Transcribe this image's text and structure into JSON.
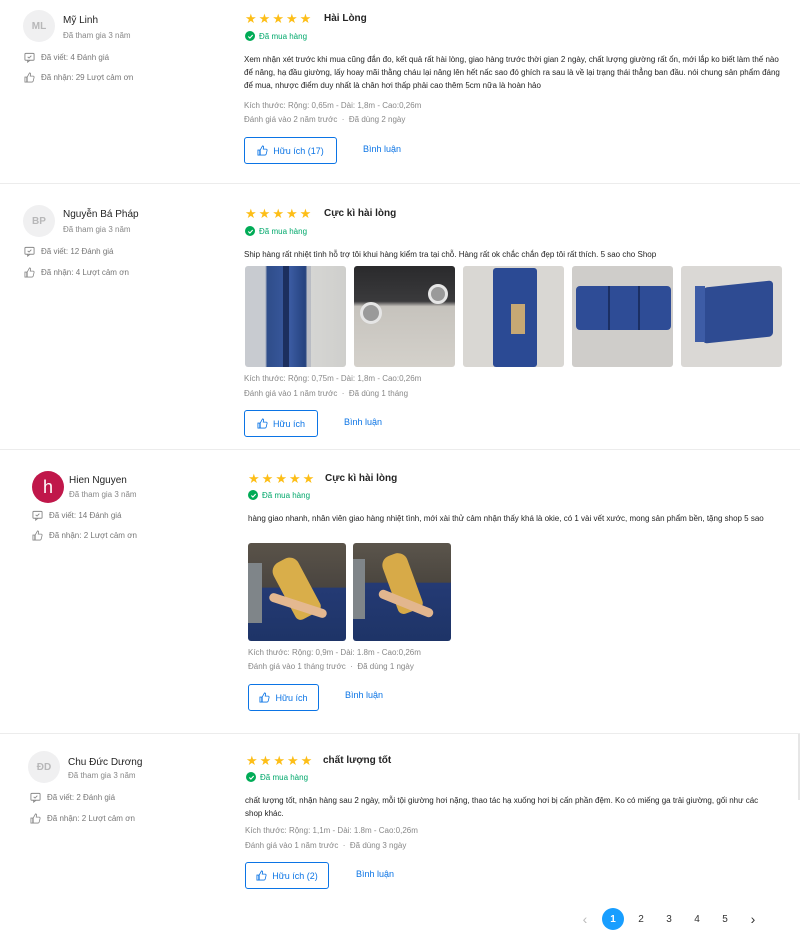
{
  "reviews": [
    {
      "user": {
        "initials": "ML",
        "name": "Mỹ Linh",
        "joined": "Đã tham gia 3 năm",
        "written": "Đã viết: 4 Đánh giá",
        "received": "Đã nhận: 29 Lượt cảm ơn"
      },
      "stars": 5,
      "title": "Hài Lòng",
      "bought": "Đã mua hàng",
      "content": "Xem nhận xét trước khi mua cũng đắn đo, kết quả rất hài lòng, giao hàng trước thời gian 2 ngày, chất lượng giường rất ổn, mới lắp ko biết làm thế nào để nâng, hạ đầu giường, lấy hoay mãi thằng cháu lại nâng lên hết nấc sao đó ghích ra sau là về lại trạng thái thẳng ban đầu. nói chung sản phẩm đáng để mua, nhược điểm duy nhất là chân hơi thấp phải cao thêm 5cm nữa là hoàn hảo",
      "size": "Kích thước: Rộng: 0,65m - Dài: 1,8m - Cao:0,26m",
      "reviewed": "Đánh giá vào 2 năm trước",
      "used": "Đã dùng 2 ngày",
      "helpful": "Hữu ích (17)",
      "comment": "Bình luận"
    },
    {
      "user": {
        "initials": "BP",
        "name": "Nguyễn Bá Pháp",
        "joined": "Đã tham gia 3 năm",
        "written": "Đã viết: 12 Đánh giá",
        "received": "Đã nhận: 4 Lượt cảm ơn"
      },
      "stars": 5,
      "title": "Cực kì hài lòng",
      "bought": "Đã mua hàng",
      "content": "Ship hàng rất nhiệt tình hỗ trợ tôi khui hàng kiểm tra tại chỗ. Hàng rất ok chắc chắn đẹp tôi rất thích. 5 sao cho Shop",
      "size": "Kích thước: Rộng: 0,75m - Dài: 1,8m - Cao:0,26m",
      "reviewed": "Đánh giá vào 1 năm trước",
      "used": "Đã dùng 1 tháng",
      "helpful": "Hữu ích",
      "comment": "Bình luận"
    },
    {
      "user": {
        "initials": "h",
        "name": "Hien Nguyen",
        "joined": "Đã tham gia 3 năm",
        "written": "Đã viết: 14 Đánh giá",
        "received": "Đã nhận: 2 Lượt cảm ơn"
      },
      "stars": 5,
      "title": "Cực kì hài lòng",
      "bought": "Đã mua hàng",
      "content": "hàng giao nhanh, nhân viên giao hàng nhiệt tình, mới xài thử cảm nhận thấy khá là okie, có 1 vài vết xước, mong sản phẩm bền, tặng shop 5 sao",
      "size": "Kích thước: Rộng: 0,9m - Dài: 1.8m - Cao:0,26m",
      "reviewed": "Đánh giá vào 1 tháng trước",
      "used": "Đã dùng 1 ngày",
      "helpful": "Hữu ích",
      "comment": "Bình luận"
    },
    {
      "user": {
        "initials": "ĐD",
        "name": "Chu Đức Dương",
        "joined": "Đã tham gia 3 năm",
        "written": "Đã viết: 2 Đánh giá",
        "received": "Đã nhận: 2 Lượt cảm ơn"
      },
      "stars": 5,
      "title": "chất lượng tốt",
      "bought": "Đã mua hàng",
      "content": "chất lượng tốt, nhận hàng sau 2 ngày, mỗi tội giường hơi nặng, thao tác hạ xuống hơi bị cấn phần đệm. Ko có miếng ga trải giường, gối như các shop khác.",
      "size": "Kích thước: Rộng: 1,1m - Dài: 1.8m - Cao:0,26m",
      "reviewed": "Đánh giá vào 1 năm trước",
      "used": "Đã dùng 3 ngày",
      "helpful": "Hữu ích (2)",
      "comment": "Bình luận"
    }
  ],
  "pagination": {
    "pages": [
      "1",
      "2",
      "3",
      "4",
      "5"
    ],
    "current": "1"
  },
  "colors": {
    "accent": "#0b74e5",
    "star": "#fdbe17",
    "verified": "#00ab56",
    "page_active": "#189eff"
  }
}
